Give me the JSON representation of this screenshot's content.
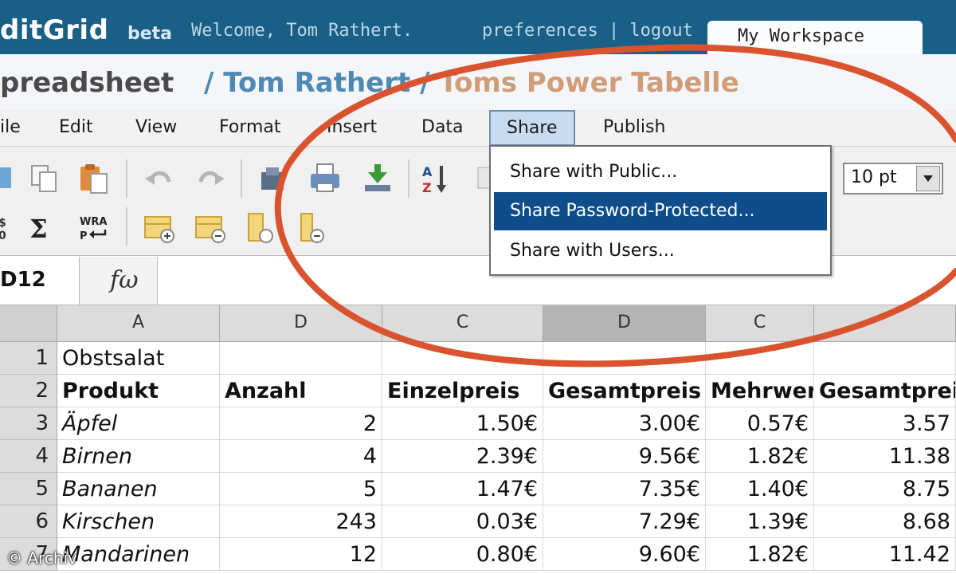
{
  "header": {
    "logo": "ditGrid",
    "beta": "beta",
    "welcome": "Welcome, Tom Rathert.",
    "links": "preferences | logout",
    "workspace_tab": "My Workspace"
  },
  "title": {
    "app": "preadsheet",
    "separator_1": "/",
    "user": "Tom Rathert",
    "separator_2": "/",
    "sheet": "Toms Power Tabelle"
  },
  "menu": {
    "items": [
      "ile",
      "Edit",
      "View",
      "Format",
      "Insert",
      "Data",
      "Share",
      "Publish"
    ],
    "active": "Share"
  },
  "share_menu": {
    "items": [
      "Share with Public...",
      "Share Password-Protected...",
      "Share with Users..."
    ],
    "highlighted": "Share Password-Protected..."
  },
  "toolbar": {
    "font_size": "10 pt",
    "icons": [
      "copy-icon",
      "paste-icon",
      "undo-icon",
      "redo-icon",
      "save-icon",
      "print-icon",
      "download-icon",
      "sort-az-icon",
      "format-icon",
      "sum-icon",
      "wrap-icon",
      "insert-row-icon",
      "delete-row-icon",
      "insert-column-icon",
      "delete-column-icon"
    ],
    "sum_label": "Σ",
    "wrap_label": "WRA",
    "wrap_label_2": "P",
    "sort_label_top": "A",
    "sort_label_bottom": "Z"
  },
  "formula_bar": {
    "cell_ref": "D12",
    "fx_label": "fω"
  },
  "grid": {
    "columns": [
      "A",
      "D",
      "C",
      "D",
      "C",
      ""
    ],
    "selected_column": 3,
    "rows": [
      {
        "num": "1",
        "cells": [
          "Obstsalat",
          "",
          "",
          "",
          "",
          ""
        ]
      },
      {
        "num": "2",
        "cells": [
          "Produkt",
          "Anzahl",
          "Einzelpreis",
          "Gesamtpreis",
          "Mehrwer",
          "Gesamtprei"
        ]
      },
      {
        "num": "3",
        "cells": [
          "Äpfel",
          "2",
          "1.50€",
          "3.00€",
          "0.57€",
          "3.57"
        ]
      },
      {
        "num": "4",
        "cells": [
          "Birnen",
          "4",
          "2.39€",
          "9.56€",
          "1.82€",
          "11.38"
        ]
      },
      {
        "num": "5",
        "cells": [
          "Bananen",
          "5",
          "1.47€",
          "7.35€",
          "1.40€",
          "8.75"
        ]
      },
      {
        "num": "6",
        "cells": [
          "Kirschen",
          "243",
          "0.03€",
          "7.29€",
          "1.39€",
          "8.68"
        ]
      },
      {
        "num": "7",
        "cells": [
          "Mandarinen",
          "12",
          "0.80€",
          "9.60€",
          "1.82€",
          "11.42"
        ]
      }
    ]
  },
  "watermark": "© Archiv",
  "colors": {
    "header_bg": "#1a5f86",
    "menu_highlight": "#0f4d8a",
    "annotation": "#d9532f",
    "sheet_name": "#d09d78",
    "user_link": "#4e89b5"
  }
}
